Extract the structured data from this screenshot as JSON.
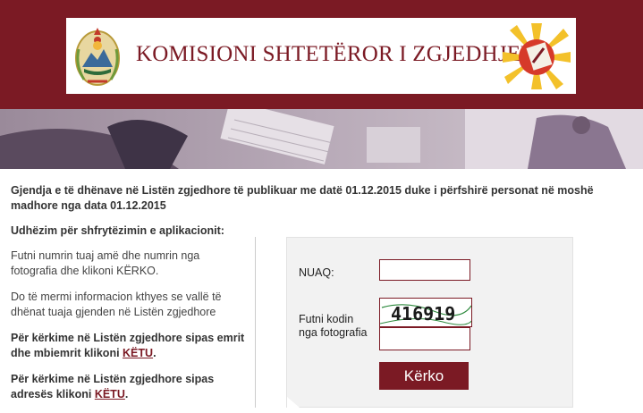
{
  "header": {
    "title": "KOMISIONI SHTETËROR I ZGJEDHJEVE",
    "emblem_icon": "state-emblem",
    "logo_icon": "sun-logo",
    "brand_color": "#7b1a24"
  },
  "intro": "Gjendja e të dhënave në Listën zgjedhore të publikuar me datë 01.12.2015 duke i përfshirë personat në moshë madhore nga data 01.12.2015",
  "instructions": {
    "title": "Udhëzim për shfrytëzimin e aplikacionit:",
    "p1": "Futni numrin tuaj amë dhe numrin nga fotografia dhe klikoni KËRKO.",
    "p2": "Do të mermi informacion kthyes se vallë të dhënat tuaja gjenden në Listën zgjedhore",
    "p3_text": "Për kërkime në Listën zgjedhore sipas emrit dhe mbiemrit klikoni ",
    "p3_link": "KËTU",
    "p4_text": "Për kërkime në Listën zgjedhore sipas adresës klikoni ",
    "p4_link": "KËTU",
    "period": "."
  },
  "form": {
    "nuaq_label": "NUAQ:",
    "nuaq_value": "",
    "code_label_1": "Futni kodin",
    "code_label_2": "nga fotografia",
    "captcha_text": "416919",
    "code_value": "",
    "submit_label": "Kërko"
  }
}
